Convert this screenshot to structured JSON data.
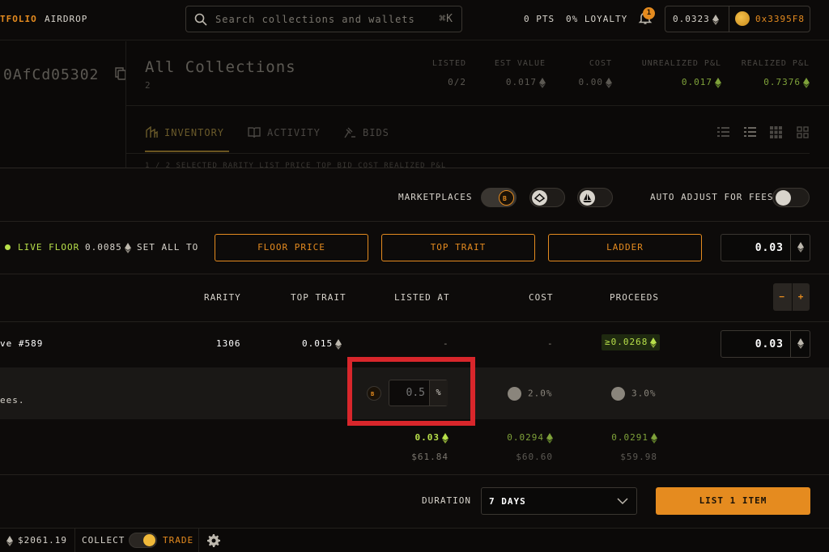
{
  "topbar": {
    "nav_portfolio": "TFOLIO",
    "nav_airdrop": "AIRDROP",
    "search_placeholder": "Search collections and wallets",
    "search_shortcut": "⌘K",
    "pts": "0 PTS",
    "loyalty": "0% LOYALTY",
    "notification_count": "1",
    "wallet_balance": "0.0323",
    "wallet_address": "0x3395F8"
  },
  "header": {
    "address": "0AfCd05302",
    "title": "All Collections",
    "count": "2",
    "stats": [
      {
        "label": "LISTED",
        "value": "0/2"
      },
      {
        "label": "EST VALUE",
        "value": "0.017"
      },
      {
        "label": "COST",
        "value": "0.00"
      },
      {
        "label": "UNREALIZED P&L",
        "value": "0.017"
      },
      {
        "label": "REALIZED P&L",
        "value": "0.7376"
      }
    ],
    "tabs": [
      "INVENTORY",
      "ACTIVITY",
      "BIDS"
    ],
    "peek_row": "1 / 2 SELECTED          RARITY        LIST PRICE        TOP BID        COST     REALIZED P&L"
  },
  "listing": {
    "marketplaces_label": "MARKETPLACES",
    "auto_adjust_label": "AUTO ADJUST FOR FEES",
    "live_floor_label": "LIVE FLOOR",
    "live_floor_value": "0.0085",
    "set_all_label": "SET ALL TO",
    "floor_price_button": "FLOOR PRICE",
    "top_trait_button": "TOP TRAIT",
    "ladder_button": "LADDER",
    "set_all_price": "0.03",
    "columns": [
      "RARITY",
      "TOP TRAIT",
      "LISTED AT",
      "COST",
      "PROCEEDS"
    ],
    "item": {
      "name": "ve #589",
      "rarity": "1306",
      "top_trait": "0.015",
      "listed_at": "-",
      "cost": "-",
      "proceeds": "≥0.0268",
      "price": "0.03"
    },
    "fees": {
      "label": "ees.",
      "blur_fee_placeholder": "0.5",
      "pct_symbol": "%",
      "opensea_fee": "2.0%",
      "looksrare_fee": "3.0%"
    },
    "totals": [
      {
        "eth": "0.03",
        "usd": "$61.84"
      },
      {
        "eth": "0.0294",
        "usd": "$60.60"
      },
      {
        "eth": "0.0291",
        "usd": "$59.98"
      }
    ],
    "duration_label": "DURATION",
    "duration_value": "7 DAYS",
    "list_button": "LIST 1 ITEM"
  },
  "footer": {
    "eth_price": "$2061.19",
    "collect_label": "COLLECT",
    "trade_label": "TRADE"
  },
  "colors": {
    "accent": "#e58b1f",
    "positive": "#b8e04a",
    "highlight": "#d8262b"
  }
}
